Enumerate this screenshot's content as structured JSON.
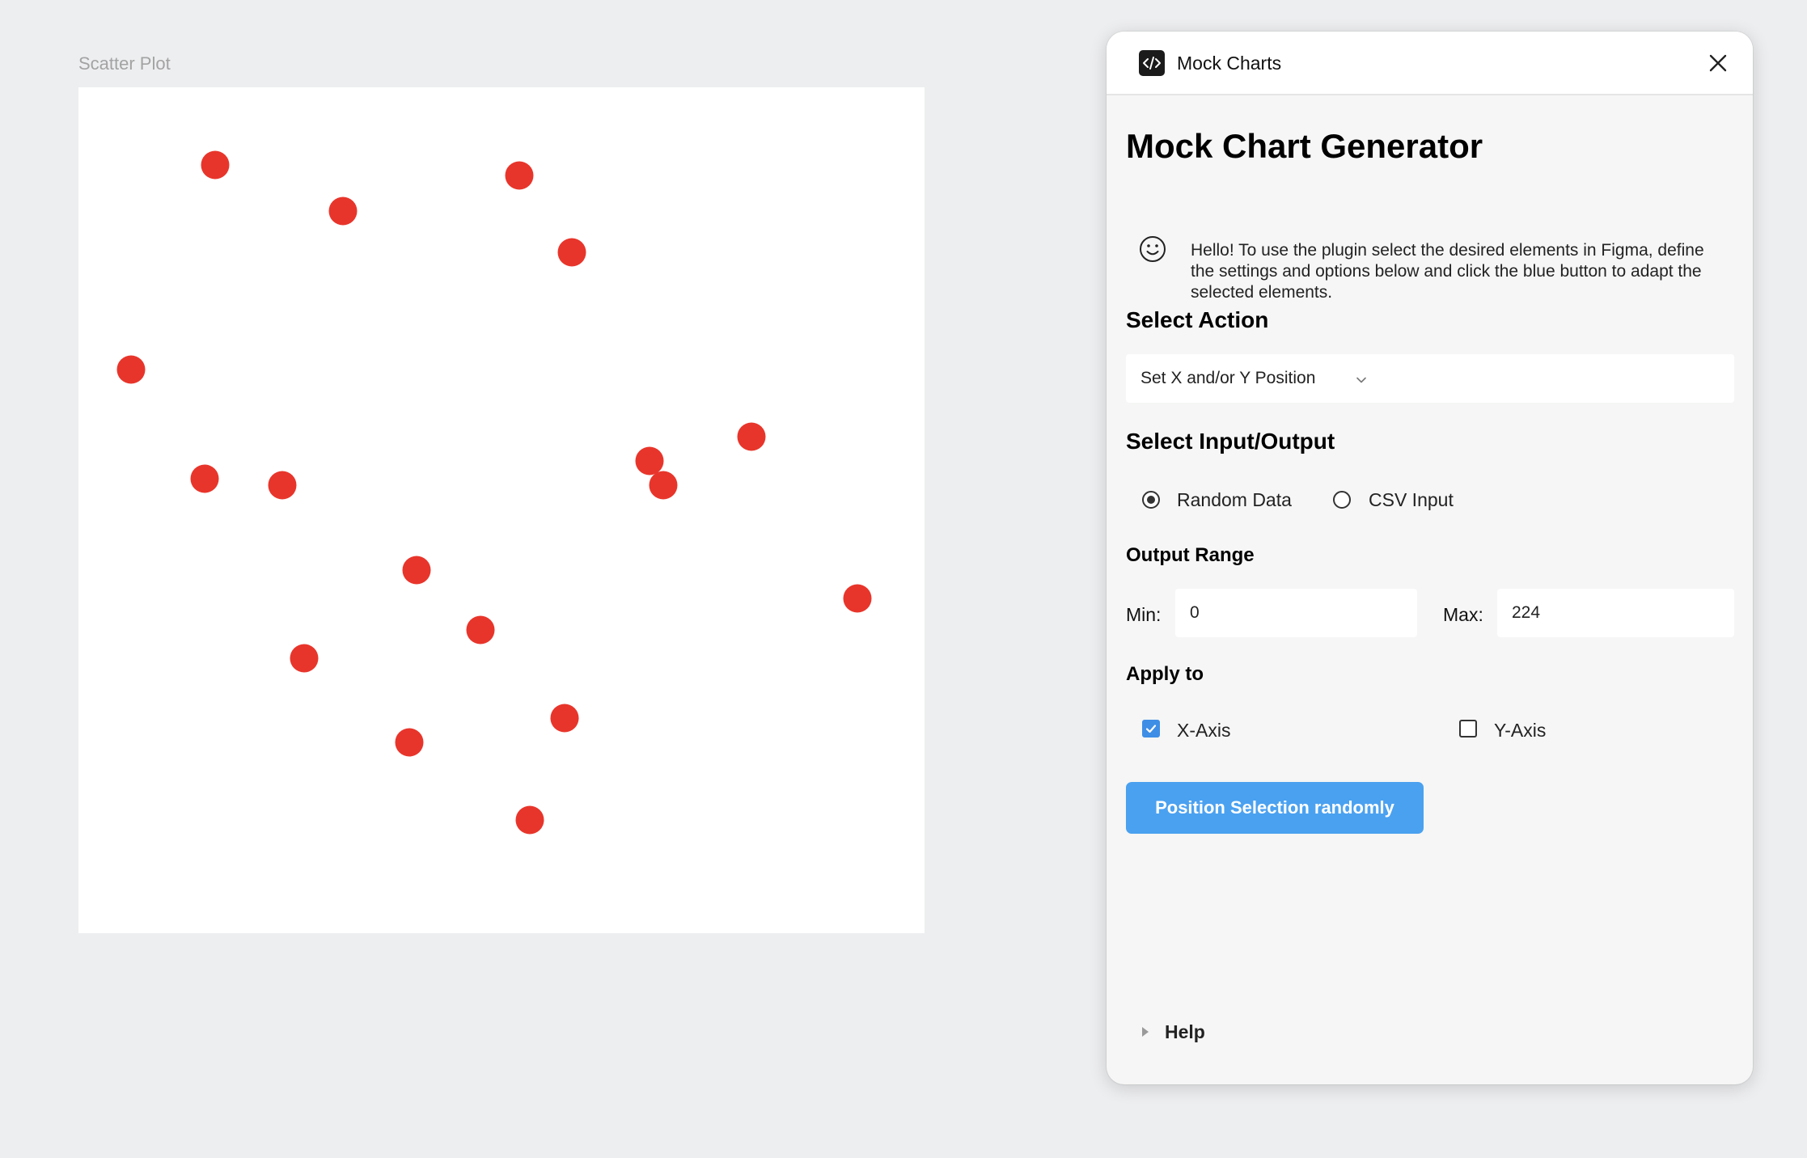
{
  "canvas": {
    "frame_label": "Scatter Plot",
    "point_color": "#e8352b",
    "background_color": "#edeef0"
  },
  "chart_data": {
    "type": "scatter",
    "title": "",
    "xlabel": "",
    "ylabel": "",
    "grid": false,
    "xlim": [
      0,
      1046
    ],
    "ylim": [
      0,
      1046
    ],
    "points": [
      {
        "x": 169,
        "y": 96
      },
      {
        "x": 327,
        "y": 153
      },
      {
        "x": 545,
        "y": 109
      },
      {
        "x": 610,
        "y": 204
      },
      {
        "x": 65,
        "y": 349
      },
      {
        "x": 156,
        "y": 484
      },
      {
        "x": 252,
        "y": 492
      },
      {
        "x": 706,
        "y": 462
      },
      {
        "x": 723,
        "y": 492
      },
      {
        "x": 832,
        "y": 432
      },
      {
        "x": 418,
        "y": 597
      },
      {
        "x": 963,
        "y": 632
      },
      {
        "x": 497,
        "y": 671
      },
      {
        "x": 279,
        "y": 706
      },
      {
        "x": 601,
        "y": 780
      },
      {
        "x": 409,
        "y": 810
      },
      {
        "x": 558,
        "y": 906
      }
    ]
  },
  "plugin": {
    "window_title": "Mock Charts",
    "icon": "code-icon",
    "close_icon": "close-icon",
    "heading": "Mock Chart Generator",
    "intro_icon": "smiley-icon",
    "intro_text": "Hello! To use the plugin select the desired elements in Figma, define the settings and options below and click the blue button to adapt the selected elements.",
    "select_action": {
      "title": "Select Action",
      "value": "Set X and/or Y Position"
    },
    "input_output": {
      "title": "Select Input/Output",
      "options": [
        {
          "label": "Random Data",
          "selected": true
        },
        {
          "label": "CSV Input",
          "selected": false
        }
      ]
    },
    "output_range": {
      "title": "Output Range",
      "min_label": "Min:",
      "min_value": "0",
      "max_label": "Max:",
      "max_value": "224"
    },
    "apply_to": {
      "title": "Apply to",
      "options": [
        {
          "label": "X-Axis",
          "checked": true
        },
        {
          "label": "Y-Axis",
          "checked": false
        }
      ]
    },
    "primary_button": "Position Selection randomly",
    "help_label": "Help",
    "accent_color": "#4aa1f0"
  }
}
